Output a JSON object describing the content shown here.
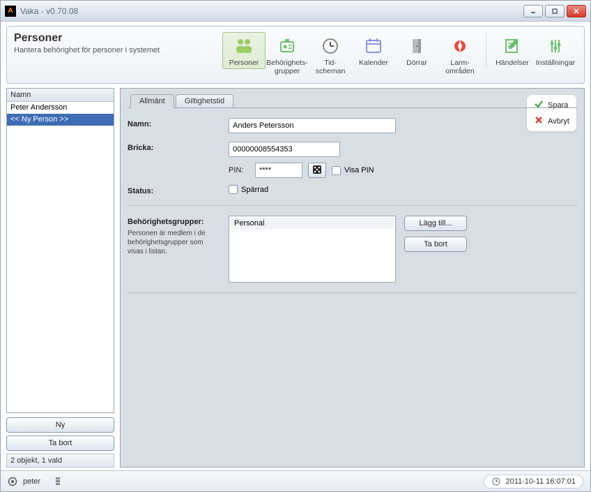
{
  "window": {
    "title": "Vaka - v0.70.08"
  },
  "header": {
    "title": "Personer",
    "subtitle": "Hantera behörighet för personer i systemet"
  },
  "toolbar": {
    "items": [
      {
        "label": "Personer",
        "icon": "people-icon",
        "active": true
      },
      {
        "label": "Behörighets-\ngrupper",
        "icon": "badge-icon"
      },
      {
        "label": "Tid-\nscheman",
        "icon": "clock-icon"
      },
      {
        "label": "Kalender",
        "icon": "calendar-icon"
      },
      {
        "label": "Dörrar",
        "icon": "door-icon"
      },
      {
        "label": "Larm-\nområden",
        "icon": "alarm-icon"
      }
    ],
    "items2": [
      {
        "label": "Händelser",
        "icon": "log-icon"
      },
      {
        "label": "Inställningar",
        "icon": "settings-icon"
      }
    ]
  },
  "left": {
    "header": "Namn",
    "rows": [
      {
        "text": "Peter Andersson",
        "selected": false
      },
      {
        "text": "<< Ny Person >>",
        "selected": true
      }
    ],
    "ny_btn": "Ny",
    "tabort_btn": "Ta bort",
    "status": "2 objekt, 1 vald"
  },
  "tabs": {
    "allmant": "Allmänt",
    "giltighetstid": "Giltighetstid"
  },
  "form": {
    "namn_label": "Namn:",
    "namn_value": "Anders Petersson",
    "bricka_label": "Bricka:",
    "bricka_value": "00000008554353",
    "pin_label": "PIN:",
    "pin_value": "****",
    "visa_pin_label": "Visa PIN",
    "status_label": "Status:",
    "sparrad_label": "Spärrad",
    "grupper_label": "Behörighetsgrupper:",
    "grupper_help": "Personen är medlem i de behörighetsgrupper som visas i listan.",
    "grupper_items": [
      "Personal"
    ],
    "lagg_till_btn": "Lägg till...",
    "tabort_btn": "Ta bort"
  },
  "actions": {
    "spara": "Spara",
    "avbryt": "Avbryt"
  },
  "statusbar": {
    "user": "peter",
    "datetime": "2011-10-11 16:07:01"
  },
  "colors": {
    "accent_green": "#8bc34a",
    "selection": "#3e6db5"
  }
}
